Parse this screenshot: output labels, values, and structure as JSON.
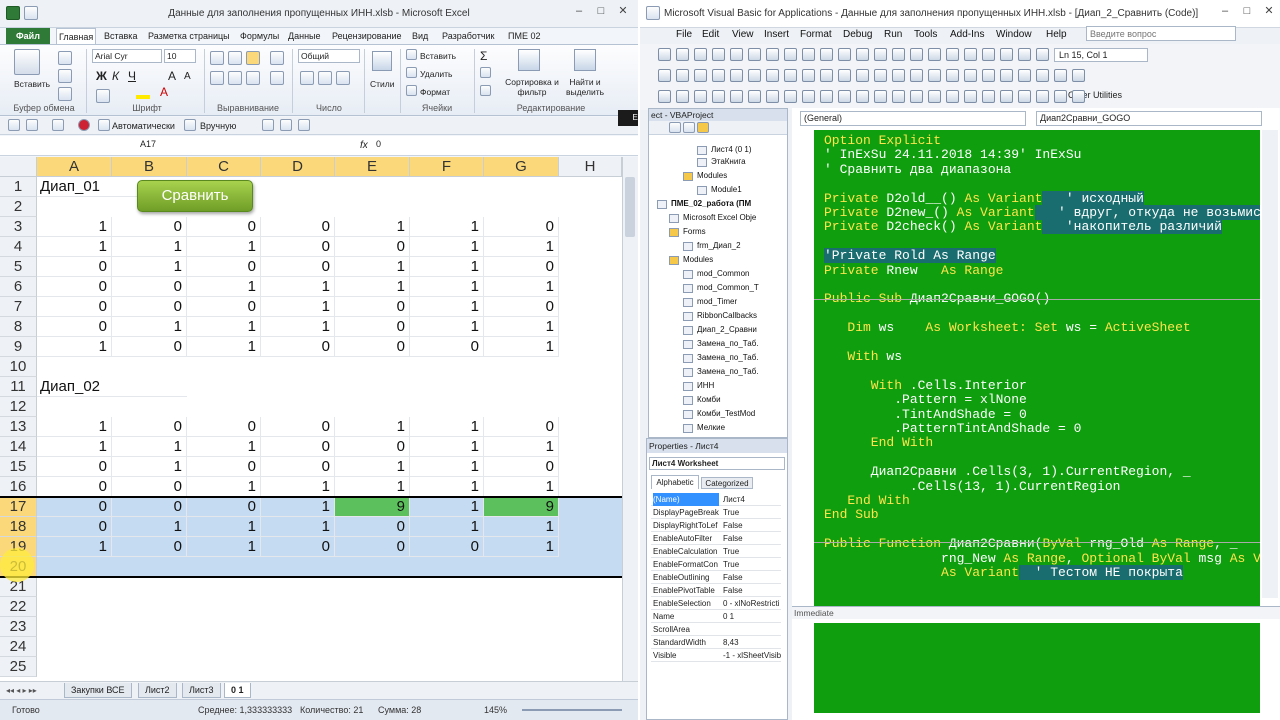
{
  "excel": {
    "title": "Данные для заполнения пропущенных ИНН.xlsb - Microsoft Excel",
    "tabs": [
      "Файл",
      "Главная",
      "Вставка",
      "Разметка страницы",
      "Формулы",
      "Данные",
      "Рецензирование",
      "Вид",
      "Разработчик",
      "ПМЕ 02"
    ],
    "ribbon": {
      "paste": "Вставить",
      "clipboard_group": "Буфер обмена",
      "font_name": "Arial Cyr",
      "font_size": "10",
      "font_group": "Шрифт",
      "align_group": "Выравнивание",
      "number_format": "Общий",
      "number_group": "Число",
      "styles": "Стили",
      "insert": "Вставить",
      "delete": "Удалить",
      "format": "Формат",
      "cells_group": "Ячейки",
      "sort": "Сортировка и фильтр",
      "find": "Найти и выделить",
      "edit_group": "Редактирование"
    },
    "qat": {
      "calc_auto": "Автоматически",
      "calc_manual": "Вручную",
      "lang": "EN"
    },
    "name_box": "A17",
    "formula": "0",
    "columns": [
      "A",
      "B",
      "C",
      "D",
      "E",
      "F",
      "G",
      "H"
    ],
    "rows": [
      {
        "n": "1",
        "label": "Диап_01"
      },
      {
        "n": "2"
      },
      {
        "n": "3",
        "v": [
          "1",
          "0",
          "0",
          "0",
          "1",
          "1",
          "0"
        ]
      },
      {
        "n": "4",
        "v": [
          "1",
          "1",
          "1",
          "0",
          "0",
          "1",
          "1"
        ]
      },
      {
        "n": "5",
        "v": [
          "0",
          "1",
          "0",
          "0",
          "1",
          "1",
          "0"
        ]
      },
      {
        "n": "6",
        "v": [
          "0",
          "0",
          "1",
          "1",
          "1",
          "1",
          "1"
        ]
      },
      {
        "n": "7",
        "v": [
          "0",
          "0",
          "0",
          "1",
          "0",
          "1",
          "0"
        ]
      },
      {
        "n": "8",
        "v": [
          "0",
          "1",
          "1",
          "1",
          "0",
          "1",
          "1"
        ]
      },
      {
        "n": "9",
        "v": [
          "1",
          "0",
          "1",
          "0",
          "0",
          "0",
          "1"
        ]
      },
      {
        "n": "10"
      },
      {
        "n": "11",
        "label": "Диап_02"
      },
      {
        "n": "12"
      },
      {
        "n": "13",
        "v": [
          "1",
          "0",
          "0",
          "0",
          "1",
          "1",
          "0"
        ]
      },
      {
        "n": "14",
        "v": [
          "1",
          "1",
          "1",
          "0",
          "0",
          "1",
          "1"
        ]
      },
      {
        "n": "15",
        "v": [
          "0",
          "1",
          "0",
          "0",
          "1",
          "1",
          "0"
        ]
      },
      {
        "n": "16",
        "v": [
          "0",
          "0",
          "1",
          "1",
          "1",
          "1",
          "1"
        ]
      },
      {
        "n": "17",
        "v": [
          "0",
          "0",
          "0",
          "1",
          "9",
          "1",
          "9"
        ]
      },
      {
        "n": "18",
        "v": [
          "0",
          "1",
          "1",
          "1",
          "0",
          "1",
          "1"
        ]
      },
      {
        "n": "19",
        "v": [
          "1",
          "0",
          "1",
          "0",
          "0",
          "0",
          "1"
        ]
      },
      {
        "n": "20"
      },
      {
        "n": "21"
      },
      {
        "n": "22"
      },
      {
        "n": "23"
      },
      {
        "n": "24"
      },
      {
        "n": "25"
      }
    ],
    "compare_button": "Сравнить",
    "sheet_tabs": [
      "Закупки ВСЕ",
      "Лист2",
      "Лист3",
      "0 1"
    ],
    "status": {
      "ready": "Готово",
      "avg": "Среднее: 1,333333333",
      "count": "Количество: 21",
      "sum": "Сумма: 28",
      "zoom": "145%"
    }
  },
  "vba": {
    "title": "Microsoft Visual Basic for Applications - Данные для заполнения пропущенных ИНН.xlsb - [Диап_2_Сравнить (Code)]",
    "menu": [
      "File",
      "Edit",
      "View",
      "Insert",
      "Format",
      "Debug",
      "Run",
      "Tools",
      "Add-Ins",
      "Window",
      "Help"
    ],
    "search_placeholder": "Введите вопрос",
    "cursor_pos": "Ln 15, Col 1",
    "other_utilities": "Other Utilities",
    "project_header": "ect - VBAProject",
    "tree": [
      "Лист4 (0 1)",
      "ЭтаКнига",
      "Modules",
      "Module1",
      "ПМЕ_02_работа (ПМ",
      "Microsoft Excel Obje",
      "Forms",
      "frm_Диап_2",
      "Modules",
      "mod_Common",
      "mod_Common_T",
      "mod_Timer",
      "RibbonCallbacks",
      "Диап_2_Сравни",
      "Замена_по_Таб.",
      "Замена_по_Таб.",
      "Замена_по_Таб.",
      "ИНН",
      "Комби",
      "Комби_TestMod",
      "Мелкие"
    ],
    "props_header": "Properties - Лист4",
    "props_object": "Лист4 Worksheet",
    "props_tabs": [
      "Alphabetic",
      "Categorized"
    ],
    "props": [
      [
        "(Name)",
        "Лист4"
      ],
      [
        "DisplayPageBreak",
        "True"
      ],
      [
        "DisplayRightToLef",
        "False"
      ],
      [
        "EnableAutoFilter",
        "False"
      ],
      [
        "EnableCalculation",
        "True"
      ],
      [
        "EnableFormatCon",
        "True"
      ],
      [
        "EnableOutlining",
        "False"
      ],
      [
        "EnablePivotTable",
        "False"
      ],
      [
        "EnableSelection",
        "0 - xlNoRestricti"
      ],
      [
        "Name",
        "0 1"
      ],
      [
        "ScrollArea",
        ""
      ],
      [
        "StandardWidth",
        "8,43"
      ],
      [
        "Visible",
        "-1 - xlSheetVisib"
      ]
    ],
    "general_combo": "(General)",
    "proc_combo": "Диап2Сравни_GOGO",
    "code": [
      [
        {
          "k": 1,
          "t": "Option Explicit"
        }
      ],
      [
        {
          "t": "' InExSu 24.11.2018 14:39' InExSu"
        }
      ],
      [
        {
          "t": "' Сравнить два диапазона"
        }
      ],
      [],
      [
        {
          "k": 1,
          "t": "Private "
        },
        {
          "t": "D2old__() "
        },
        {
          "k": 1,
          "t": "As Variant"
        },
        {
          "h": 1,
          "t": "   ' исходный"
        }
      ],
      [
        {
          "k": 1,
          "t": "Private "
        },
        {
          "t": "D2new_() "
        },
        {
          "k": 1,
          "t": "As Variant"
        },
        {
          "h": 1,
          "t": "   ' вдруг, откуда не возьмись, появ"
        }
      ],
      [
        {
          "k": 1,
          "t": "Private "
        },
        {
          "t": "D2check() "
        },
        {
          "k": 1,
          "t": "As Variant"
        },
        {
          "h": 1,
          "t": "   'накопитель различий"
        }
      ],
      [],
      [
        {
          "h": 1,
          "t": "'Private Rold As Range"
        }
      ],
      [
        {
          "k": 1,
          "t": "Private "
        },
        {
          "t": "Rnew   "
        },
        {
          "k": 1,
          "t": "As Range"
        }
      ],
      [],
      [
        {
          "k": 1,
          "t": "Public Sub "
        },
        {
          "t": "Диап2Сравни_GOGO()"
        }
      ],
      [],
      [
        {
          "k": 1,
          "t": "   Dim "
        },
        {
          "t": "ws    "
        },
        {
          "k": 1,
          "t": "As Worksheet: Set "
        },
        {
          "t": "ws = "
        },
        {
          "k": 1,
          "t": "ActiveSheet"
        }
      ],
      [],
      [
        {
          "k": 1,
          "t": "   With "
        },
        {
          "t": "ws"
        }
      ],
      [],
      [
        {
          "k": 1,
          "t": "      With "
        },
        {
          "t": ".Cells.Interior"
        }
      ],
      [
        {
          "t": "         .Pattern = xlNone"
        }
      ],
      [
        {
          "t": "         .TintAndShade = 0"
        }
      ],
      [
        {
          "t": "         .PatternTintAndShade = 0"
        }
      ],
      [
        {
          "k": 1,
          "t": "      End With"
        }
      ],
      [],
      [
        {
          "t": "      Диап2Сравни .Cells(3, 1).CurrentRegion, _"
        }
      ],
      [
        {
          "t": "           .Cells(13, 1).CurrentRegion"
        }
      ],
      [
        {
          "k": 1,
          "t": "   End With"
        }
      ],
      [
        {
          "k": 1,
          "t": "End Sub"
        }
      ],
      [],
      [
        {
          "k": 1,
          "t": "Public Function "
        },
        {
          "t": "Диап2Сравни("
        },
        {
          "k": 1,
          "t": "ByVal "
        },
        {
          "t": "rng_Old "
        },
        {
          "k": 1,
          "t": "As Range"
        },
        {
          "t": ", _"
        }
      ],
      [
        {
          "t": "               rng_New "
        },
        {
          "k": 1,
          "t": "As Range"
        },
        {
          "t": ", "
        },
        {
          "k": 1,
          "t": "Optional ByVal "
        },
        {
          "t": "msg "
        },
        {
          "k": 1,
          "t": "As Va"
        }
      ],
      [
        {
          "k": 1,
          "t": "               As Variant"
        },
        {
          "h": 1,
          "t": "  ' Тестом НЕ покрыта"
        }
      ]
    ],
    "immediate_header": "Immediate"
  }
}
